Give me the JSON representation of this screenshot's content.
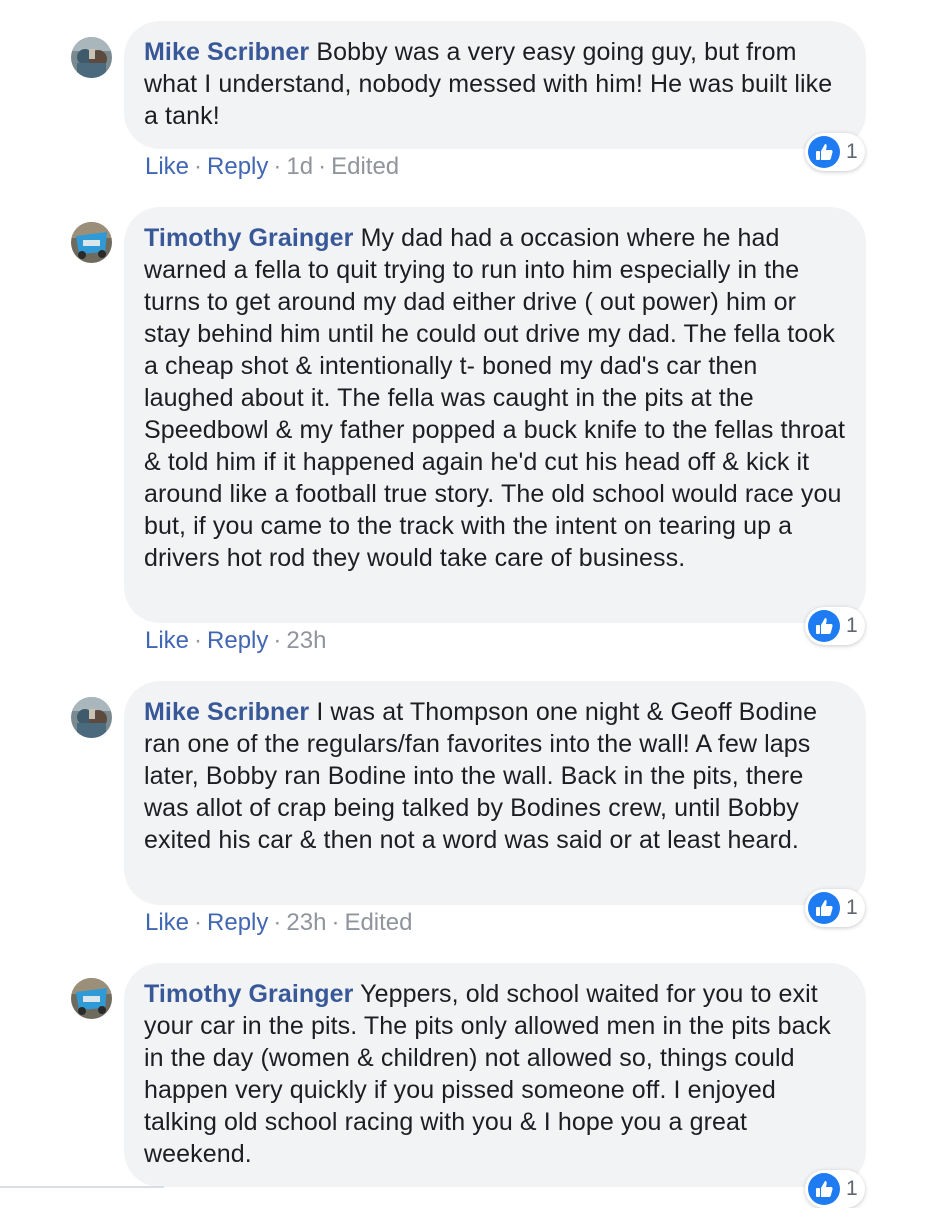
{
  "colors": {
    "author": "#385898",
    "action_link": "#4267b2",
    "meta": "#90949c",
    "bubble": "#f2f3f5",
    "like_badge": "#1f7bf2"
  },
  "reaction_icon": "like-thumbs-up-icon",
  "comments": [
    {
      "author": "Mike Scribner",
      "text": "Bobby was a very easy going guy, but from what I understand, nobody messed with him! He was built like a tank!",
      "actions": {
        "like": "Like",
        "reply": "Reply",
        "time": "1d",
        "edited": "Edited"
      },
      "reactions": "1"
    },
    {
      "author": "Timothy Grainger",
      "text": "My dad had a occasion where he had warned a fella to quit trying to run into him especially in the turns to get around my dad either drive ( out power) him or stay behind him until he could out drive my dad. The fella took a cheap shot & intentionally t- boned my dad's car then laughed about it. The fella was caught in the pits at the Speedbowl & my father popped a buck knife to the fellas throat & told him if it happened again he'd cut his head off & kick it around like a football true story. The old school would race you but, if you came to the track with the intent on tearing up a drivers hot rod they would take care of business.",
      "actions": {
        "like": "Like",
        "reply": "Reply",
        "time": "23h"
      },
      "reactions": "1"
    },
    {
      "author": "Mike Scribner",
      "text": "I was at Thompson one night & Geoff Bodine ran one of the regulars/fan favorites into the wall! A few laps later, Bobby ran Bodine into the wall. Back in the pits, there was allot of crap being talked by Bodines crew, until Bobby exited his car & then not a word was said or at least heard.",
      "actions": {
        "like": "Like",
        "reply": "Reply",
        "time": "23h",
        "edited": "Edited"
      },
      "reactions": "1"
    },
    {
      "author": "Timothy Grainger",
      "text": "Yeppers, old school waited for you to exit your car in the pits. The pits only allowed men in the pits back in the day (women & children) not allowed so, things could happen very quickly if you pissed someone off. I enjoyed talking old school racing with you & I hope you a great weekend.",
      "actions": {},
      "reactions": "1"
    }
  ]
}
